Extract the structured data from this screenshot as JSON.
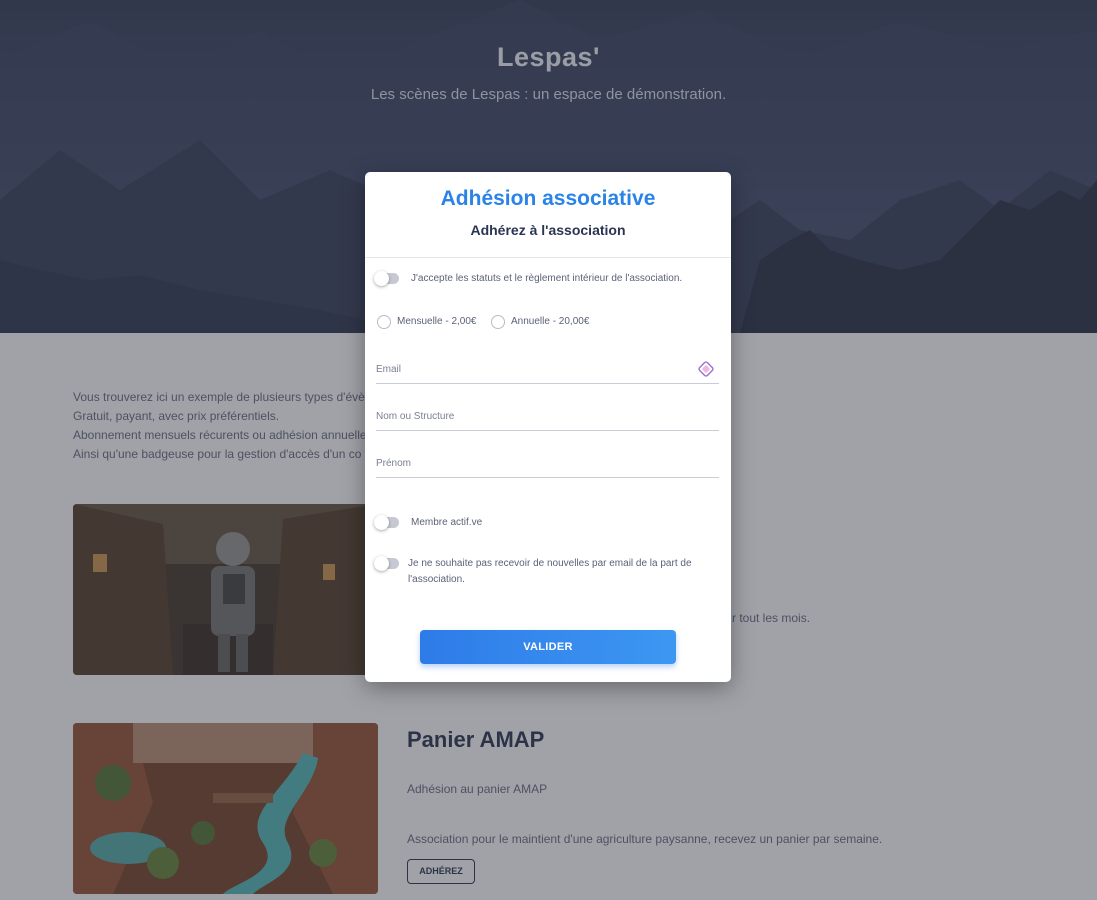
{
  "hero": {
    "title": "Lespas'",
    "subtitle": "Les scènes de Lespas : un espace de démonstration."
  },
  "intro": {
    "lines": [
      "Vous trouverez ici un exemple de plusieurs types d'évèn",
      "Gratuit, payant, avec prix préférentiels.",
      "Abonnement mensuels récurents ou adhésion annuelle.",
      "Ainsi qu'une badgeuse pour la gestion d'accès d'un co w"
    ]
  },
  "cards": [
    {
      "description": "r tout les mois."
    },
    {
      "title": "Panier AMAP",
      "subtitle": "Adhésion au panier AMAP",
      "description": "Association pour le maintient d'une agriculture paysanne, recevez un panier par semaine.",
      "button": "ADHÉREZ"
    }
  ],
  "modal": {
    "title": "Adhésion associative",
    "subtitle": "Adhérez à l'association",
    "accept_statuts": "J'accepte les statuts et le règlement intérieur de l'association.",
    "options": [
      "Mensuelle - 2,00€",
      "Annuelle - 20,00€"
    ],
    "fields": {
      "email": "Email",
      "nom": "Nom ou Structure",
      "prenom": "Prénom"
    },
    "membre_actif": "Membre actif.ve",
    "no_news": "Je ne souhaite pas recevoir de nouvelles par email de la part de l'association.",
    "submit": "VALIDER"
  },
  "colors": {
    "accent": "#2a83e6",
    "text_dark": "#1f2a48",
    "text_muted": "#5b6279"
  }
}
